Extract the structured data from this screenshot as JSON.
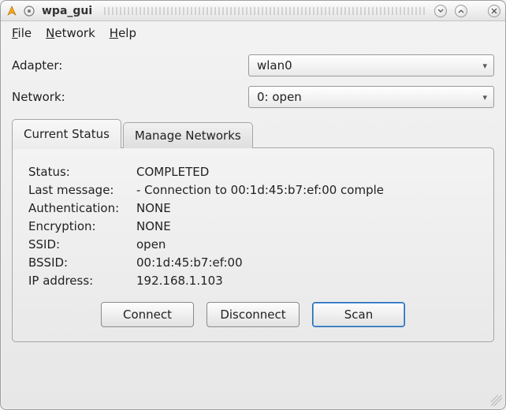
{
  "title": "wpa_gui",
  "menubar": {
    "file": "File",
    "network": "Network",
    "help": "Help"
  },
  "forms": {
    "adapter": {
      "label": "Adapter:",
      "value": "wlan0"
    },
    "network": {
      "label": "Network:",
      "value": "0: open"
    }
  },
  "tabs": {
    "current_status": "Current Status",
    "manage_networks": "Manage Networks"
  },
  "status": {
    "status": {
      "label": "Status:",
      "value": "COMPLETED"
    },
    "last_message": {
      "label": "Last message:",
      "value": "- Connection to 00:1d:45:b7:ef:00 comple"
    },
    "authentication": {
      "label": "Authentication:",
      "value": "NONE"
    },
    "encryption": {
      "label": "Encryption:",
      "value": "NONE"
    },
    "ssid": {
      "label": "SSID:",
      "value": "open"
    },
    "bssid": {
      "label": "BSSID:",
      "value": "00:1d:45:b7:ef:00"
    },
    "ip": {
      "label": "IP address:",
      "value": "192.168.1.103"
    }
  },
  "buttons": {
    "connect": "Connect",
    "disconnect": "Disconnect",
    "scan": "Scan"
  }
}
